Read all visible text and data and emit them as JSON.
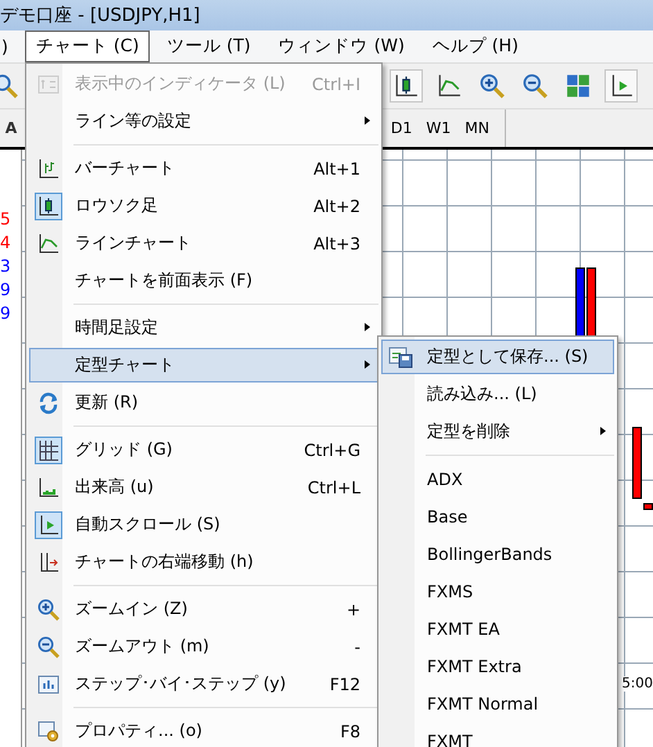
{
  "window": {
    "title": "デモ口座 - [USDJPY,H1]"
  },
  "menu_bar": [
    {
      "label": ")",
      "selected": false
    },
    {
      "label": "チャート (C)",
      "selected": true
    },
    {
      "label": "ツール (T)",
      "selected": false
    },
    {
      "label": "ウィンドウ (W)",
      "selected": false
    },
    {
      "label": "ヘルプ (H)",
      "selected": false
    }
  ],
  "toolbar": [
    {
      "kind": "search",
      "checked": false
    },
    {
      "kind": "candles",
      "checked": true
    },
    {
      "kind": "line",
      "checked": false
    },
    {
      "kind": "zoom_in",
      "checked": false
    },
    {
      "kind": "zoom_out",
      "checked": false
    },
    {
      "kind": "tile",
      "checked": false
    },
    {
      "kind": "autoscroll",
      "checked": true
    }
  ],
  "period_bar": {
    "left_label": "A",
    "periods": [
      "D1",
      "W1",
      "MN"
    ]
  },
  "left_panel": {
    "values": [
      {
        "text": "5",
        "color": "#ff0000"
      },
      {
        "text": "4",
        "color": "#ff0000"
      },
      {
        "text": "3",
        "color": "#0000ff"
      },
      {
        "text": "9",
        "color": "#0000ff"
      },
      {
        "text": "9",
        "color": "#0000ff"
      }
    ]
  },
  "chart": {
    "time_label": "5:00"
  },
  "chart_menu": {
    "items": [
      {
        "kind": "item",
        "label": "表示中のインディケータ (L)",
        "shortcut": "Ctrl+I",
        "disabled": true,
        "checked": false,
        "selected": false,
        "submenu": false
      },
      {
        "kind": "item",
        "label": "ライン等の設定",
        "disabled": false,
        "checked": false,
        "selected": false,
        "submenu": true
      },
      {
        "kind": "separator"
      },
      {
        "kind": "item",
        "label": "バーチャート",
        "shortcut": "Alt+1",
        "disabled": false,
        "checked": false,
        "selected": false,
        "submenu": false
      },
      {
        "kind": "item",
        "label": "ロウソク足",
        "shortcut": "Alt+2",
        "disabled": false,
        "checked": true,
        "selected": false,
        "submenu": false
      },
      {
        "kind": "item",
        "label": "ラインチャート",
        "shortcut": "Alt+3",
        "disabled": false,
        "checked": false,
        "selected": false,
        "submenu": false
      },
      {
        "kind": "item",
        "label": "チャートを前面表示 (F)",
        "disabled": false,
        "checked": false,
        "selected": false,
        "submenu": false
      },
      {
        "kind": "separator"
      },
      {
        "kind": "item",
        "label": "時間足設定",
        "disabled": false,
        "checked": false,
        "selected": false,
        "submenu": true
      },
      {
        "kind": "item",
        "label": "定型チャート",
        "disabled": false,
        "checked": false,
        "selected": true,
        "submenu": true
      },
      {
        "kind": "item",
        "label": "更新 (R)",
        "disabled": false,
        "checked": false,
        "selected": false,
        "submenu": false
      },
      {
        "kind": "separator"
      },
      {
        "kind": "item",
        "label": "グリッド (G)",
        "shortcut": "Ctrl+G",
        "disabled": false,
        "checked": true,
        "selected": false,
        "submenu": false
      },
      {
        "kind": "item",
        "label": "出来高 (u)",
        "shortcut": "Ctrl+L",
        "disabled": false,
        "checked": false,
        "selected": false,
        "submenu": false
      },
      {
        "kind": "item",
        "label": "自動スクロール (S)",
        "disabled": false,
        "checked": true,
        "selected": false,
        "submenu": false
      },
      {
        "kind": "item",
        "label": "チャートの右端移動 (h)",
        "disabled": false,
        "checked": false,
        "selected": false,
        "submenu": false
      },
      {
        "kind": "separator"
      },
      {
        "kind": "item",
        "label": "ズームイン (Z)",
        "shortcut": "+",
        "disabled": false,
        "checked": false,
        "selected": false,
        "submenu": false
      },
      {
        "kind": "item",
        "label": "ズームアウト (m)",
        "shortcut": "-",
        "disabled": false,
        "checked": false,
        "selected": false,
        "submenu": false
      },
      {
        "kind": "item",
        "label": "ステップ･バイ･ステップ (y)",
        "shortcut": "F12",
        "disabled": false,
        "checked": false,
        "selected": false,
        "submenu": false
      },
      {
        "kind": "separator"
      },
      {
        "kind": "item",
        "label": "プロパティ... (o)",
        "shortcut": "F8",
        "disabled": false,
        "checked": false,
        "selected": false,
        "submenu": false
      }
    ]
  },
  "template_submenu": {
    "items": [
      {
        "kind": "item",
        "label": "定型として保存... (S)",
        "selected": true,
        "submenu": false
      },
      {
        "kind": "item",
        "label": "読み込み... (L)",
        "selected": false,
        "submenu": false
      },
      {
        "kind": "item",
        "label": "定型を削除",
        "selected": false,
        "submenu": true
      },
      {
        "kind": "separator"
      },
      {
        "kind": "item",
        "label": "ADX",
        "selected": false,
        "submenu": false
      },
      {
        "kind": "item",
        "label": "Base",
        "selected": false,
        "submenu": false
      },
      {
        "kind": "item",
        "label": "BollingerBands",
        "selected": false,
        "submenu": false
      },
      {
        "kind": "item",
        "label": "FXMS",
        "selected": false,
        "submenu": false
      },
      {
        "kind": "item",
        "label": "FXMT EA",
        "selected": false,
        "submenu": false
      },
      {
        "kind": "item",
        "label": "FXMT Extra",
        "selected": false,
        "submenu": false
      },
      {
        "kind": "item",
        "label": "FXMT Normal",
        "selected": false,
        "submenu": false
      },
      {
        "kind": "item",
        "label": "FXMT",
        "selected": false,
        "submenu": false
      }
    ]
  }
}
